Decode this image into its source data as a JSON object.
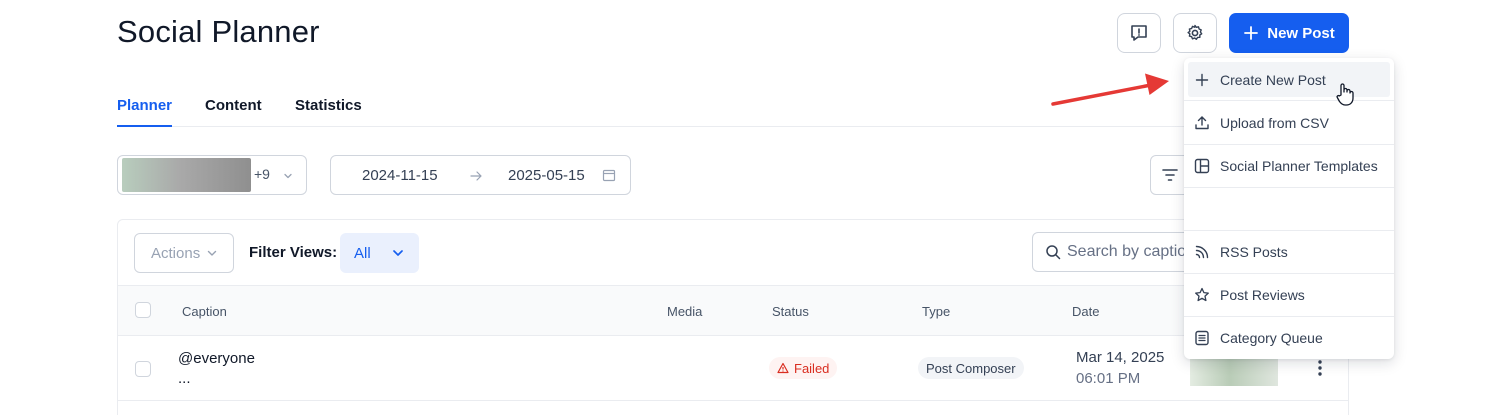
{
  "page": {
    "title": "Social Planner"
  },
  "header": {
    "new_post_label": "New Post"
  },
  "tabs": [
    {
      "label": "Planner",
      "active": true
    },
    {
      "label": "Content",
      "active": false
    },
    {
      "label": "Statistics",
      "active": false
    }
  ],
  "accounts": {
    "extra_count": "+9"
  },
  "date_range": {
    "start": "2024-11-15",
    "end": "2025-05-15"
  },
  "toolbar": {
    "actions_label": "Actions",
    "filter_views_label": "Filter Views:",
    "filter_view_value": "All",
    "search_placeholder": "Search by caption"
  },
  "table": {
    "columns": [
      "Caption",
      "Media",
      "Status",
      "Type",
      "Date"
    ],
    "rows": [
      {
        "caption_line1": "@everyone",
        "caption_line2": "...",
        "status": "Failed",
        "type": "Post Composer",
        "date": "Mar 14, 2025",
        "time": "06:01 PM"
      }
    ]
  },
  "dropdown": {
    "items": [
      {
        "label": "Create New Post",
        "icon": "plus-icon"
      },
      {
        "label": "Upload from CSV",
        "icon": "upload-icon"
      },
      {
        "label": "Social Planner Templates",
        "icon": "template-icon"
      },
      {
        "label": "",
        "icon": ""
      },
      {
        "label": "RSS Posts",
        "icon": "rss-icon"
      },
      {
        "label": "Post Reviews",
        "icon": "star-icon"
      },
      {
        "label": "Category Queue",
        "icon": "list-icon"
      }
    ]
  },
  "colors": {
    "primary": "#155eef",
    "failed": "#d92d20",
    "arrow": "#e53935"
  }
}
